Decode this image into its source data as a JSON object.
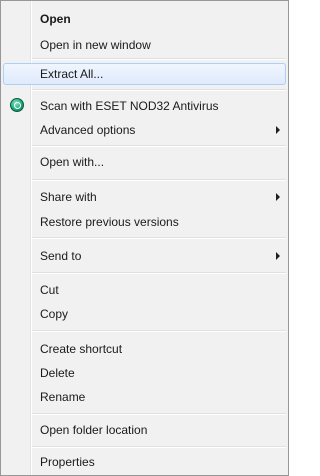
{
  "menu": {
    "items": {
      "open": "Open",
      "open_new_window": "Open in new window",
      "extract_all": "Extract All...",
      "scan_eset": "Scan with ESET NOD32 Antivirus",
      "advanced_options": "Advanced options",
      "open_with": "Open with...",
      "share_with": "Share with",
      "restore_previous": "Restore previous versions",
      "send_to": "Send to",
      "cut": "Cut",
      "copy": "Copy",
      "create_shortcut": "Create shortcut",
      "delete": "Delete",
      "rename": "Rename",
      "open_folder_location": "Open folder location",
      "properties": "Properties"
    },
    "icons": {
      "eset": "eset-scan-icon",
      "submenu": "chevron-right-icon"
    },
    "colors": {
      "background": "#f1f1f1",
      "border": "#979797",
      "highlight_border": "#aecff7",
      "highlight_fill": "#dfeafc",
      "eset_green": "#1cab7a"
    }
  }
}
